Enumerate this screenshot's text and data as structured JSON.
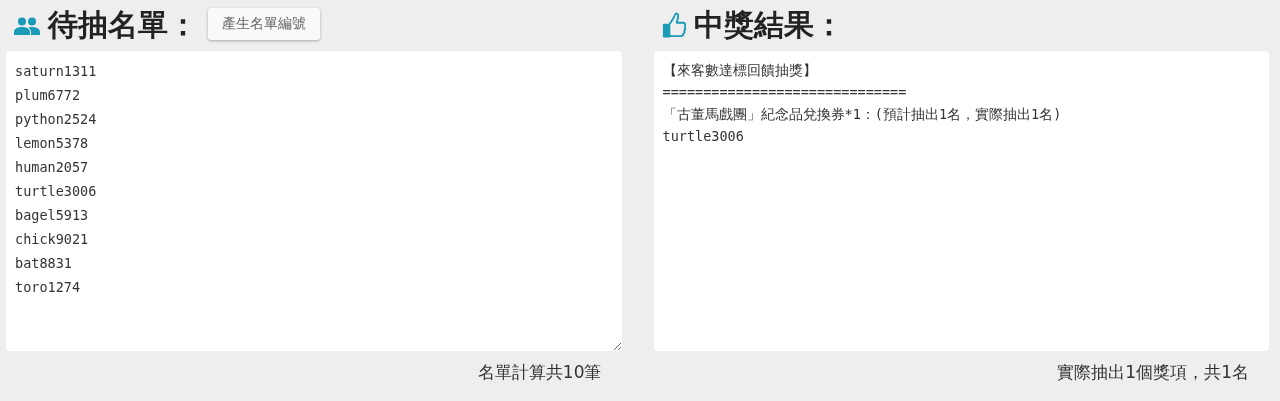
{
  "candidates": {
    "title": "待抽名單：",
    "button": "產生名單編號",
    "names": [
      "saturn1311",
      "plum6772",
      "python2524",
      "lemon5378",
      "human2057",
      "turtle3006",
      "bagel5913",
      "chick9021",
      "bat8831",
      "toro1274"
    ],
    "summary": "名單計算共10筆"
  },
  "results": {
    "title": "中獎結果：",
    "lines": [
      "【來客數達標回饋抽獎】",
      "==============================",
      "「古董馬戲團」紀念品兌換券*1：(預計抽出1名，實際抽出1名)",
      "turtle3006"
    ],
    "summary": "實際抽出1個獎項，共1名"
  }
}
